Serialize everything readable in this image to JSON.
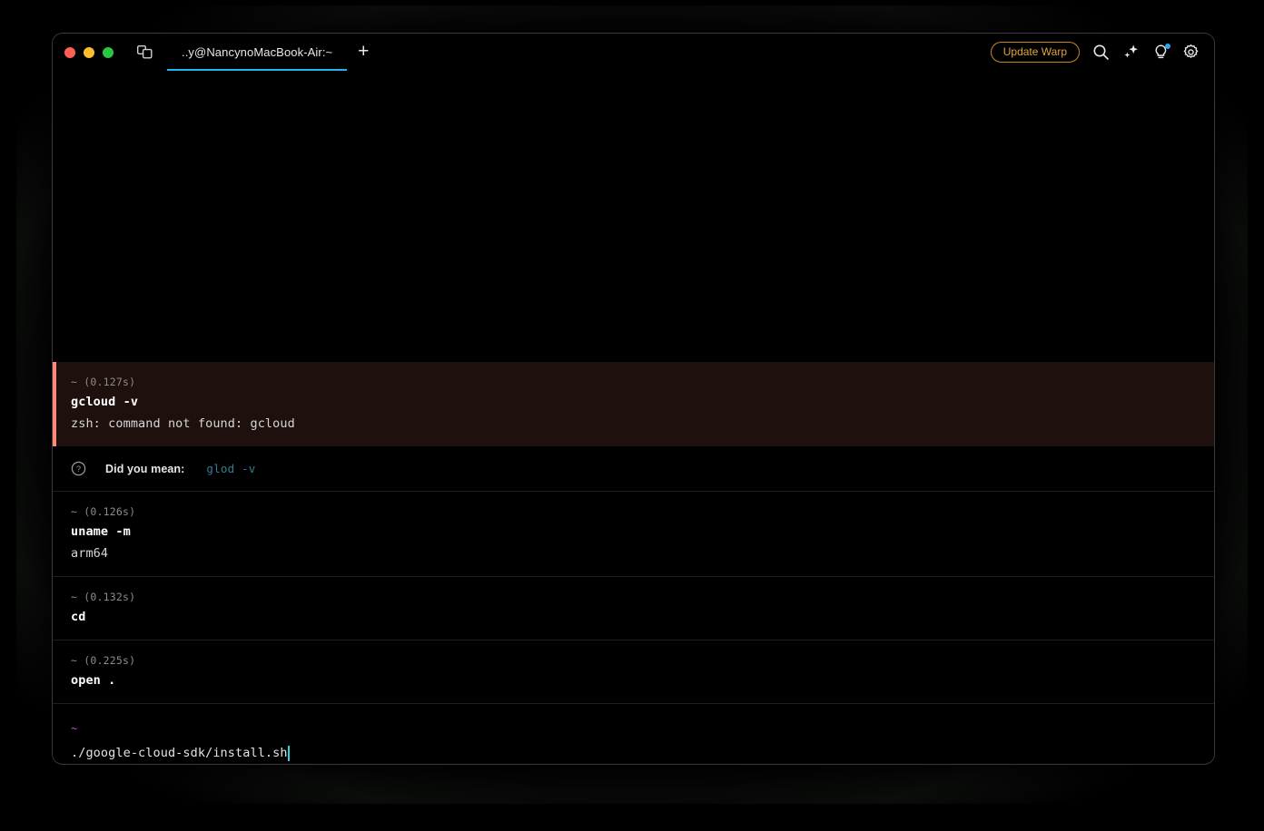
{
  "window": {
    "traffic_lights": [
      {
        "name": "close",
        "color": "#FF5F57"
      },
      {
        "name": "minimize",
        "color": "#FEBC2E"
      },
      {
        "name": "maximize",
        "color": "#28C840"
      }
    ],
    "panes_icon": "split-panes-icon"
  },
  "tabs": [
    {
      "label": "..y@NancynoMacBook-Air:~",
      "active": true
    }
  ],
  "new_tab_label": "+",
  "titlebar_actions": {
    "update_button_label": "Update Warp",
    "update_button_color": "#E2A33B",
    "icons": [
      "search-icon",
      "ai-sparkle-icon",
      "lightbulb-icon",
      "gear-icon"
    ],
    "notification_dot_color": "#2BA7F0"
  },
  "theme": {
    "background": "#000000",
    "error_block_background": "#1D100D",
    "error_accent": "#FF8A7A",
    "tab_underline": "#23B3F0",
    "prompt_path_color": "#C84FBF",
    "caret_color": "#2BD4E0",
    "suggestion_command_color": "#2E7F93"
  },
  "blocks": [
    {
      "id": "gcloud-error-block",
      "state": "error",
      "meta": "~ (0.127s)",
      "command": "gcloud -v",
      "output": "zsh: command not found: gcloud"
    },
    {
      "id": "uname-block",
      "state": "success",
      "meta": "~ (0.126s)",
      "command": "uname -m",
      "output": "arm64"
    },
    {
      "id": "cd-block",
      "state": "success",
      "meta": "~ (0.132s)",
      "command": "cd",
      "output": ""
    },
    {
      "id": "open-block",
      "state": "success",
      "meta": "~ (0.225s)",
      "command": "open .",
      "output": ""
    }
  ],
  "suggestion": {
    "icon": "question-circle-icon",
    "label": "Did you mean:",
    "command": "glod -v"
  },
  "prompt": {
    "path": "~",
    "input_value": "./google-cloud-sdk/install.sh"
  }
}
